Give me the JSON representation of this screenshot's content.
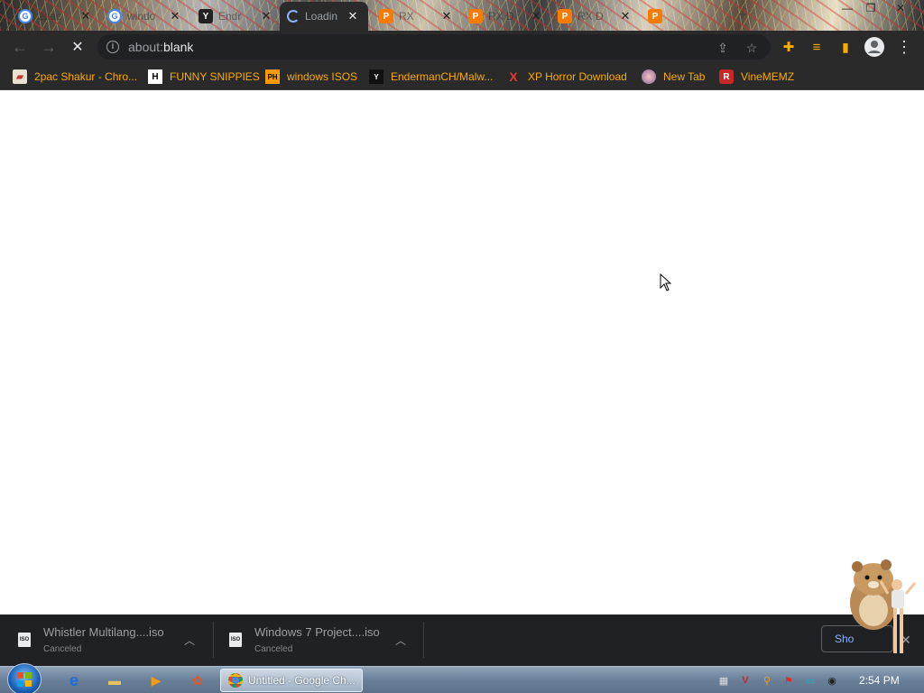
{
  "tabs": [
    {
      "title": "2pac",
      "favicon": "google-icon",
      "active": false
    },
    {
      "title": "windo",
      "favicon": "google-icon",
      "active": false
    },
    {
      "title": "Endr",
      "favicon": "yt-icon",
      "active": false
    },
    {
      "title": "Loadin",
      "favicon": "spinner-icon",
      "active": true
    },
    {
      "title": "RX",
      "favicon": "p-icon",
      "active": false
    },
    {
      "title": "RX D",
      "favicon": "p-icon",
      "active": false
    },
    {
      "title": "RX D",
      "favicon": "p-icon",
      "active": false
    },
    {
      "title": "",
      "favicon": "p-icon",
      "active": false
    }
  ],
  "toolbar": {
    "url_prefix": "about:",
    "url_host": "blank"
  },
  "bookmarks": [
    {
      "label": "2pac Shakur - Chro...",
      "icon": "bag-icon"
    },
    {
      "label": "FUNNY SNIPPIES",
      "icon": "h-icon"
    },
    {
      "label": "windows ISOS",
      "icon": "ph-icon"
    },
    {
      "label": "EndermanCH/Malw...",
      "icon": "yt-icon"
    },
    {
      "label": "XP Horror Download",
      "icon": "x-icon"
    },
    {
      "label": "New Tab",
      "icon": "globe-icon"
    },
    {
      "label": "VineMEMZ",
      "icon": "r-icon"
    }
  ],
  "downloads": [
    {
      "name": "Whistler Multilang....iso",
      "status": "Canceled"
    },
    {
      "name": "Windows 7 Project....iso",
      "status": "Canceled"
    }
  ],
  "show_all_label": "Sho",
  "taskbar": {
    "chrome_task_label": "Untitled - Google Ch...",
    "clock": "2:54 PM"
  },
  "colors": {
    "bookmark_text": "#f9ab00",
    "chrome_dark": "#2a2a2a",
    "download_bar": "#202124"
  }
}
